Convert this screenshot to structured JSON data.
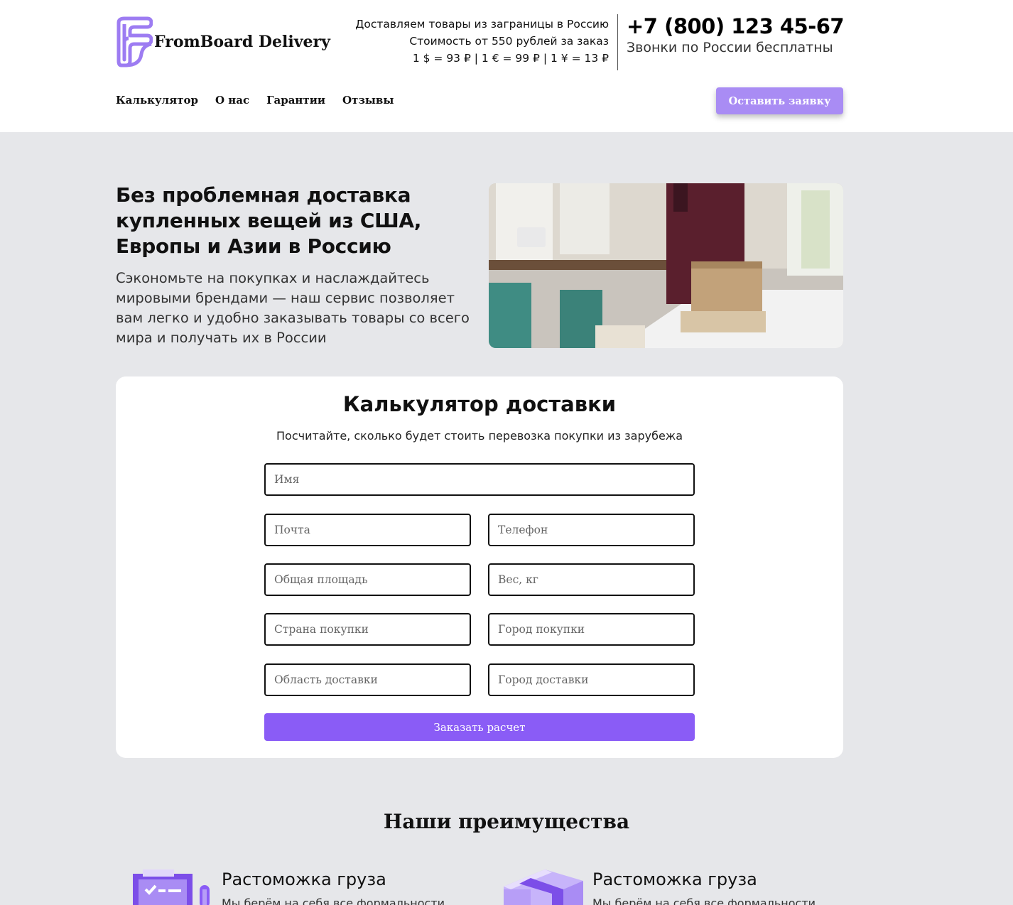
{
  "header": {
    "brand": "FromBoard Delivery",
    "info_lines": [
      "Доставляем товары из заграницы в Россию",
      "Стоимость от 550 рублей за заказ",
      "1 $ = 93 ₽ | 1 € = 99 ₽ | 1 ¥ = 13 ₽"
    ],
    "phone": "+7 (800) 123 45-67",
    "phone_note": "Звонки по России бесплатны",
    "nav": [
      "Калькулятор",
      "О нас",
      "Гарантии",
      "Отзывы"
    ],
    "cta_label": "Оставить заявку",
    "accent": "#a98cf4"
  },
  "hero": {
    "title": "Без проблемная доставка купленных вещей из США, Европы и Азии в Россию",
    "text": "Сэкономьте на покупках и наслаждайтесь мировыми брендами — наш сервис позволяет вам легко и удобно заказывать товары со всего мира и получать их в России"
  },
  "calculator": {
    "title": "Калькулятор доставки",
    "subtitle": "Посчитайте, сколько будет стоить перевозка покупки из зарубежа",
    "placeholders": {
      "name": "Имя",
      "email": "Почта",
      "phone": "Телефон",
      "area": "Общая площадь",
      "weight": "Вес, кг",
      "country": "Страна покупки",
      "buy_city": "Город покупки",
      "region": "Область доставки",
      "delivery_city": "Город доставки"
    },
    "submit_label": "Заказать расчет",
    "button_color": "#8a5cf6"
  },
  "advantages": {
    "title": "Наши преимущества",
    "items": [
      {
        "name": "Растоможка груза",
        "desc": "Мы берём на себя все формальности",
        "icon": "clipboard-icon"
      },
      {
        "name": "Растоможка груза",
        "desc": "Мы берём на себя все формальности",
        "icon": "box-icon"
      }
    ]
  }
}
